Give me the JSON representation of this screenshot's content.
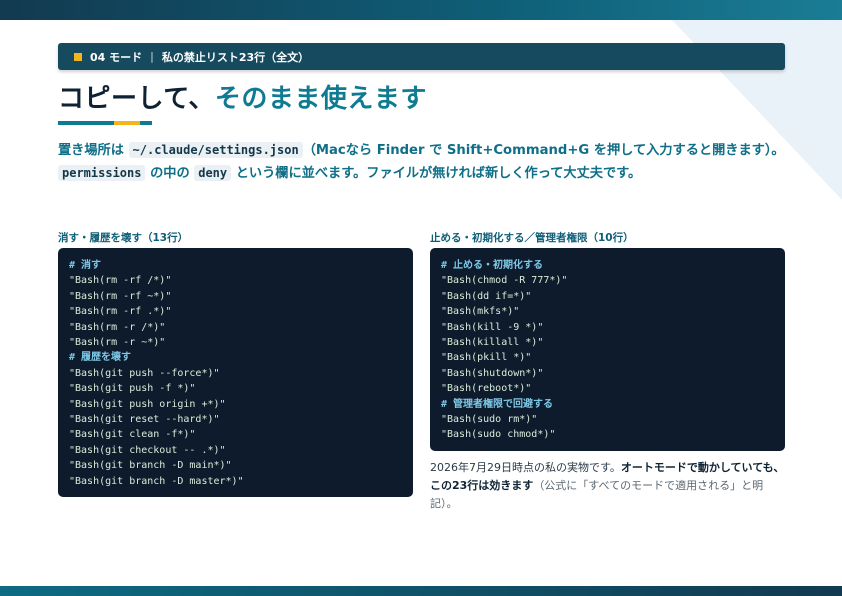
{
  "header": {
    "section": "04 モード",
    "separator": "|",
    "subtitle": "私の禁止リスト23行（全文）"
  },
  "title": {
    "main": "コピーして、",
    "accent": "そのまま使えます"
  },
  "intro": {
    "t1": "置き場所は ",
    "c1": "~/.claude/settings.json",
    "t2": "（Macなら Finder で Shift+Command+G を押して入力すると開きます）。",
    "c2": "permissions",
    "t3": " の中の ",
    "c3": "deny",
    "t4": " という欄に並べます。ファイルが無ければ新しく作って大丈夫です。"
  },
  "left_panel": {
    "label": "消す・履歴を壊す（13行）",
    "lines": [
      {
        "text": "# 消す",
        "type": "comment"
      },
      {
        "text": "\"Bash(rm -rf /*)\"",
        "type": "code"
      },
      {
        "text": "\"Bash(rm -rf ~*)\"",
        "type": "code"
      },
      {
        "text": "\"Bash(rm -rf .*)\"",
        "type": "code"
      },
      {
        "text": "\"Bash(rm -r /*)\"",
        "type": "code"
      },
      {
        "text": "\"Bash(rm -r ~*)\"",
        "type": "code"
      },
      {
        "text": "# 履歴を壊す",
        "type": "comment"
      },
      {
        "text": "\"Bash(git push --force*)\"",
        "type": "code"
      },
      {
        "text": "\"Bash(git push -f *)\"",
        "type": "code"
      },
      {
        "text": "\"Bash(git push origin +*)\"",
        "type": "code"
      },
      {
        "text": "\"Bash(git reset --hard*)\"",
        "type": "code"
      },
      {
        "text": "\"Bash(git clean -f*)\"",
        "type": "code"
      },
      {
        "text": "\"Bash(git checkout -- .*)\"",
        "type": "code"
      },
      {
        "text": "\"Bash(git branch -D main*)\"",
        "type": "code"
      },
      {
        "text": "\"Bash(git branch -D master*)\"",
        "type": "code"
      }
    ]
  },
  "right_panel": {
    "label": "止める・初期化する／管理者権限（10行）",
    "lines": [
      {
        "text": "# 止める・初期化する",
        "type": "comment"
      },
      {
        "text": "\"Bash(chmod -R 777*)\"",
        "type": "code"
      },
      {
        "text": "\"Bash(dd if=*)\"",
        "type": "code"
      },
      {
        "text": "\"Bash(mkfs*)\"",
        "type": "code"
      },
      {
        "text": "\"Bash(kill -9 *)\"",
        "type": "code"
      },
      {
        "text": "\"Bash(killall *)\"",
        "type": "code"
      },
      {
        "text": "\"Bash(pkill *)\"",
        "type": "code"
      },
      {
        "text": "\"Bash(shutdown*)\"",
        "type": "code"
      },
      {
        "text": "\"Bash(reboot*)\"",
        "type": "code"
      },
      {
        "text": "# 管理者権限で回避する",
        "type": "comment"
      },
      {
        "text": "\"Bash(sudo rm*)\"",
        "type": "code"
      },
      {
        "text": "\"Bash(sudo chmod*)\"",
        "type": "code"
      }
    ]
  },
  "note": {
    "t1": "2026年7月29日時点の私の実物です。",
    "b1": "オートモードで動かしていても、この23行は効きます",
    "t2": "（公式に「すべてのモードで適用される」と明記）。"
  },
  "colors": {
    "brand_dark": "#164a5e",
    "accent_teal": "#0f7b93",
    "accent_yellow": "#f2b51c",
    "code_bg": "#0e1b2d",
    "code_comment": "#7ec8e6",
    "code_text": "#d9ecd9"
  }
}
